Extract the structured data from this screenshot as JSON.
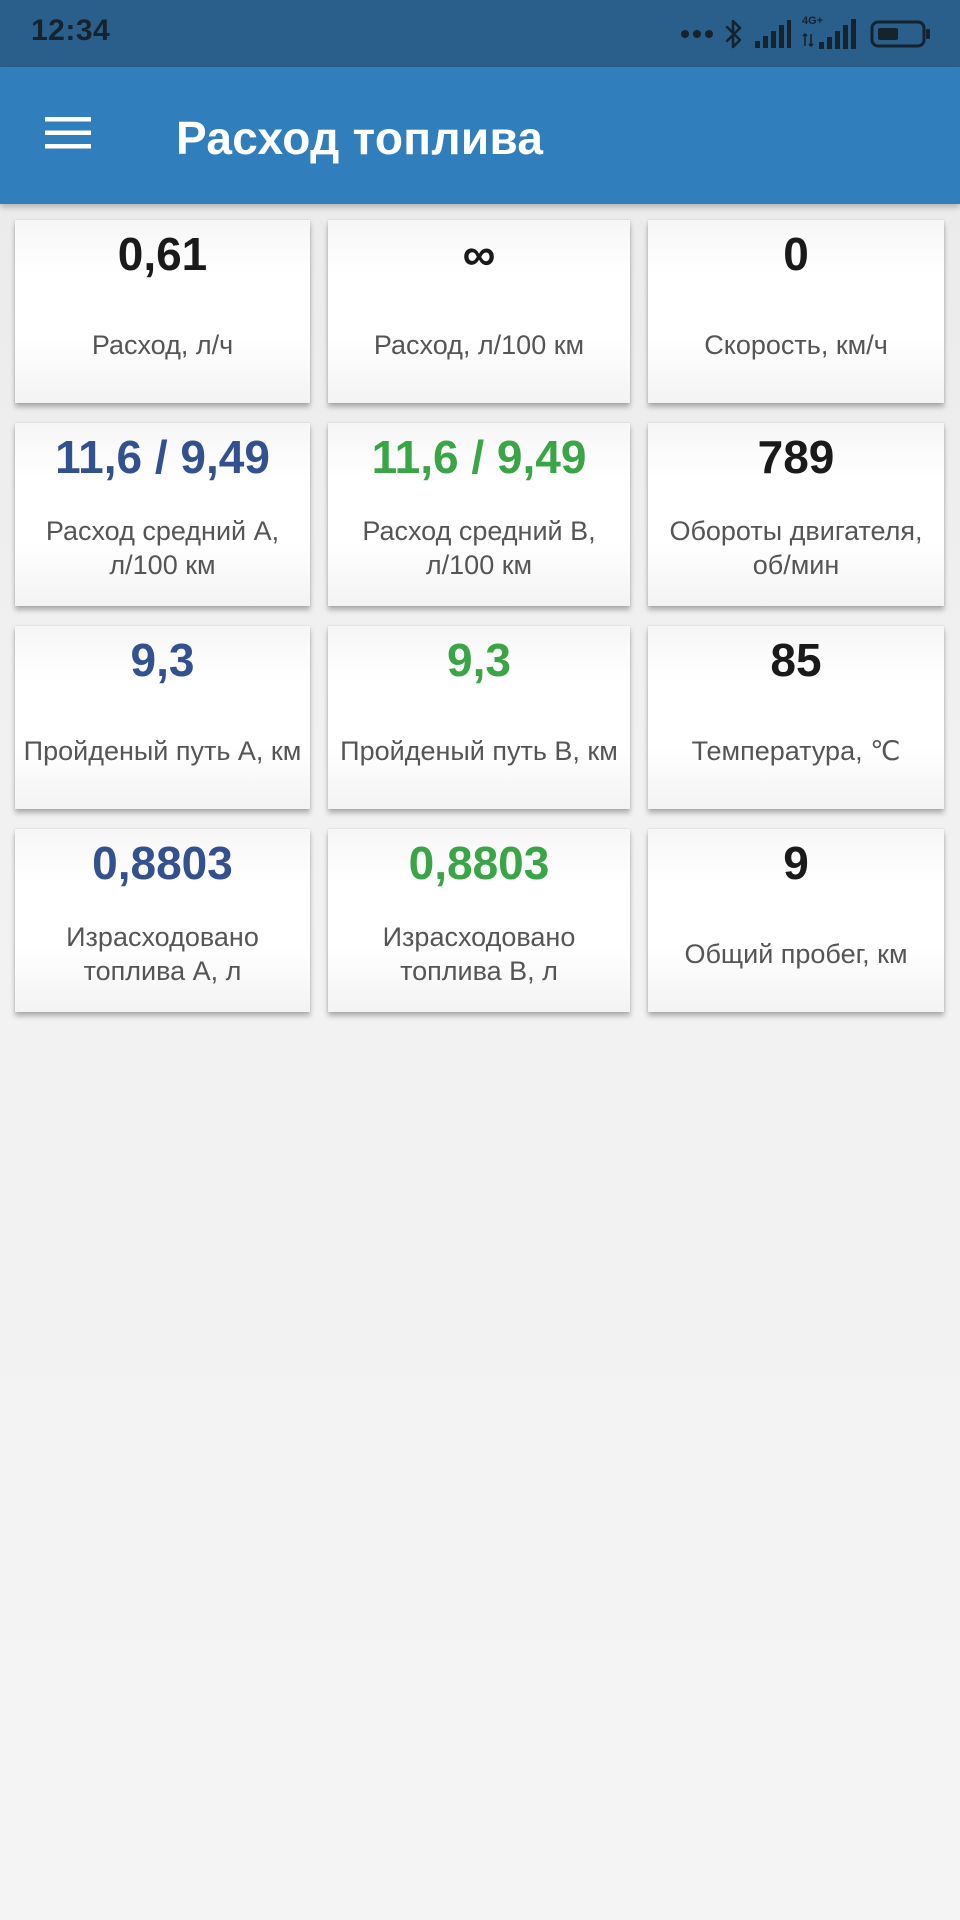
{
  "status_bar": {
    "time": "12:34",
    "network_label": "4G+"
  },
  "app_bar": {
    "title": "Расход топлива",
    "menu_icon": "hamburger-menu-icon"
  },
  "colors": {
    "status_bar_bg": "#2a5f8c",
    "app_bar_bg": "#317ebd",
    "value_default": "#1a1a1a",
    "value_a": "#33508f",
    "value_b": "#3aa546",
    "label": "#555555"
  },
  "tiles": [
    [
      {
        "value": "0,61",
        "label": "Расход, л/ч",
        "color": "#1a1a1a"
      },
      {
        "value": "∞",
        "label": "Расход, л/100 км",
        "color": "#1a1a1a"
      },
      {
        "value": "0",
        "label": "Скорость, км/ч",
        "color": "#1a1a1a"
      }
    ],
    [
      {
        "value": "11,6 / 9,49",
        "label": "Расход средний A, л/100 км",
        "color": "#33508f"
      },
      {
        "value": "11,6 / 9,49",
        "label": "Расход средний B, л/100 км",
        "color": "#3aa546"
      },
      {
        "value": "789",
        "label": "Обороты двигателя, об/мин",
        "color": "#1a1a1a"
      }
    ],
    [
      {
        "value": "9,3",
        "label": "Пройденый путь A, км",
        "color": "#33508f"
      },
      {
        "value": "9,3",
        "label": "Пройденый путь B, км",
        "color": "#3aa546"
      },
      {
        "value": "85",
        "label": "Температура, ℃",
        "color": "#1a1a1a"
      }
    ],
    [
      {
        "value": "0,8803",
        "label": "Израсходовано топлива A, л",
        "color": "#33508f"
      },
      {
        "value": "0,8803",
        "label": "Израсходовано топлива B, л",
        "color": "#3aa546"
      },
      {
        "value": "9",
        "label": "Общий пробег, км",
        "color": "#1a1a1a"
      }
    ]
  ]
}
